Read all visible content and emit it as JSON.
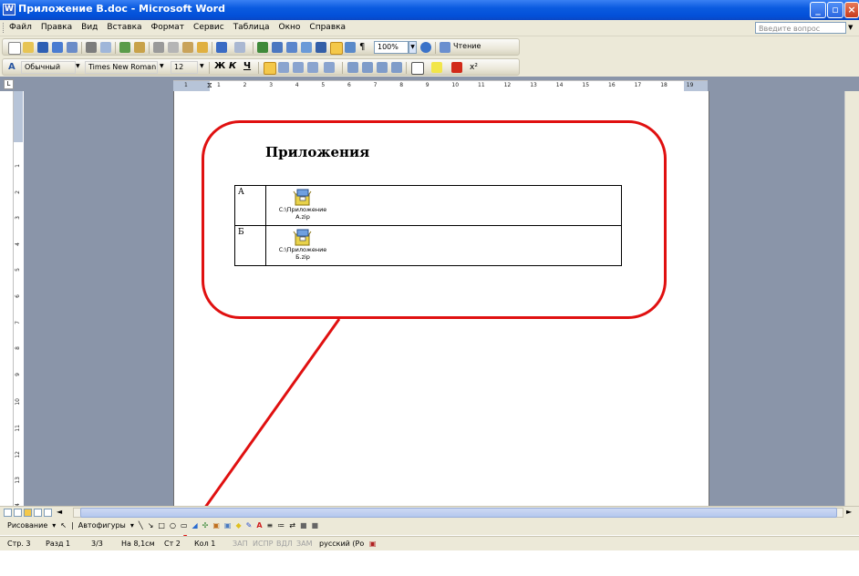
{
  "window": {
    "title": "Приложение В.doc - Microsoft Word",
    "app_icon": "word-doc-icon"
  },
  "menu": {
    "items": [
      "Файл",
      "Правка",
      "Вид",
      "Вставка",
      "Формат",
      "Сервис",
      "Таблица",
      "Окно",
      "Справка"
    ],
    "ask_placeholder": "Введите вопрос"
  },
  "toolbar_standard": {
    "zoom": "100%",
    "reading_label": "Чтение"
  },
  "toolbar_format": {
    "style": "Обычный",
    "font": "Times New Roman",
    "size": "12",
    "bold": "Ж",
    "italic": "К",
    "underline": "Ч"
  },
  "ruler": {
    "corner": "L",
    "h_numbers": [
      "1",
      "2",
      "3",
      "4",
      "5",
      "6",
      "7",
      "8",
      "9",
      "10",
      "11",
      "12",
      "13",
      "14",
      "15",
      "16",
      "17",
      "18",
      "19"
    ],
    "h_pre": [
      "1"
    ],
    "v_numbers": [
      "1",
      "2",
      "3",
      "4",
      "5",
      "6",
      "7",
      "8",
      "9",
      "10",
      "11",
      "12",
      "13",
      "14"
    ]
  },
  "document": {
    "heading": "Приложения",
    "rows": [
      {
        "letter": "А",
        "file_line1": "C:\\Приложение",
        "file_line2": "A.zip"
      },
      {
        "letter": "Б",
        "file_line1": "C:\\Приложение",
        "file_line2": "Б.zip"
      }
    ]
  },
  "drawing_toolbar": {
    "draw_label": "Рисование",
    "autoshapes_label": "Автофигуры"
  },
  "status": {
    "page": "Стр. 3",
    "section": "Разд 1",
    "pages": "3/3",
    "position": "На 8,1см",
    "line": "Ст 2",
    "column": "Кол 1",
    "rec": "ЗАП",
    "trk": "ИСПР",
    "ext": "ВДЛ",
    "ovr": "ЗАМ",
    "language": "русский (Ро"
  },
  "colors": {
    "callout": "#e01010",
    "titlebar": "#0a5be0",
    "workspace": "#8a95a9"
  }
}
